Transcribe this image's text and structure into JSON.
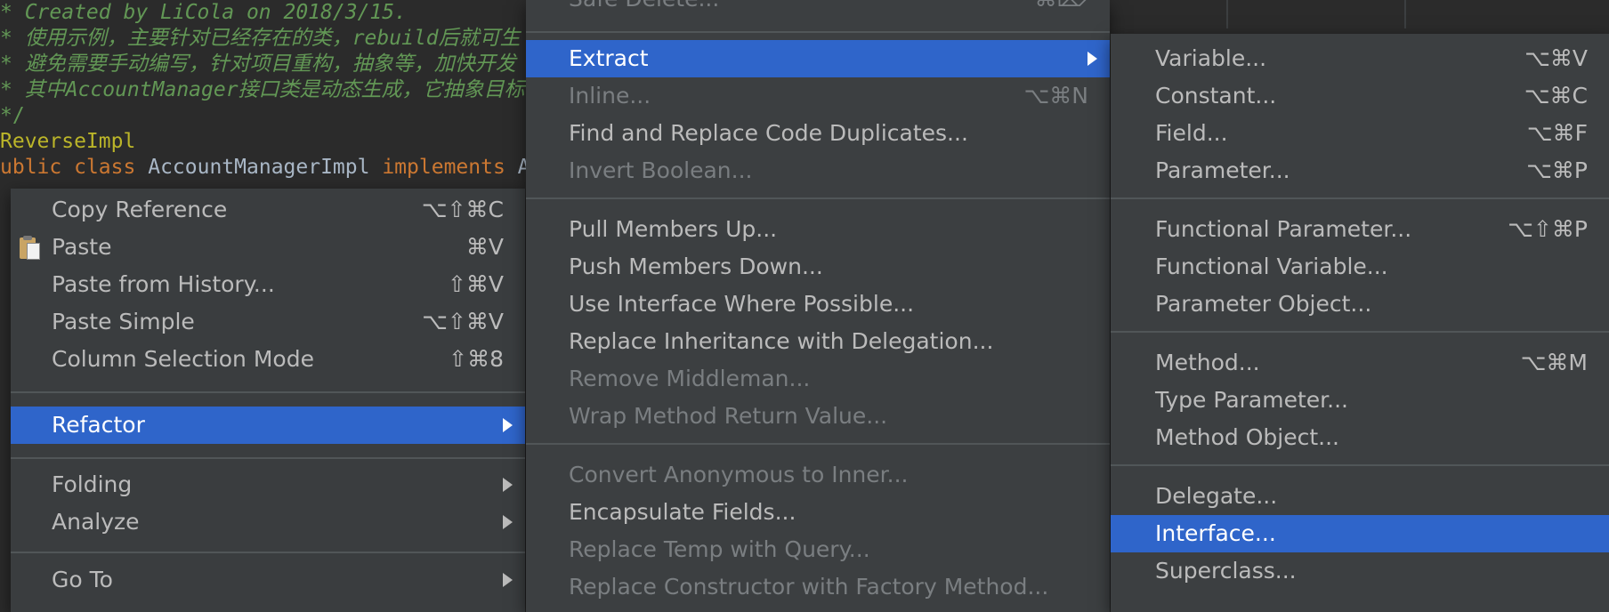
{
  "editor": {
    "lines": [
      "* Created by LiCola on 2018/3/15.",
      "* 使用示例，主要针对已经存在的类，rebuild后就可生",
      "* 避免需要手动编写，针对项目重构，抽象等，加快开发",
      "* 其中AccountManager接口类是动态生成，它抽象目标"
    ],
    "comment_end": "*/",
    "annotation": "ReverseImpl",
    "class_line": {
      "kw1": "ublic",
      "kw2": "class",
      "name": "AccountManagerImpl",
      "kw3": "implements",
      "tail": "Acc"
    }
  },
  "context_menu": {
    "items": [
      {
        "label": "Copy Reference",
        "shortcut": "⌥⇧⌘C"
      },
      {
        "label": "Paste",
        "shortcut": "⌘V",
        "icon": "paste-icon"
      },
      {
        "label": "Paste from History...",
        "shortcut": "⇧⌘V"
      },
      {
        "label": "Paste Simple",
        "shortcut": "⌥⇧⌘V"
      },
      {
        "label": "Column Selection Mode",
        "shortcut": "⇧⌘8"
      },
      {
        "label": "Refactor",
        "selected": true
      },
      {
        "label": "Folding"
      },
      {
        "label": "Analyze"
      },
      {
        "label": "Go To"
      }
    ]
  },
  "refactor_menu": {
    "items": [
      {
        "label": "Safe Delete...",
        "shortcut": "⌘⌦",
        "disabled": true
      },
      {
        "label": "Extract",
        "selected": true
      },
      {
        "label": "Inline...",
        "shortcut": "⌥⌘N",
        "disabled": true
      },
      {
        "label": "Find and Replace Code Duplicates..."
      },
      {
        "label": "Invert Boolean...",
        "disabled": true
      },
      {
        "label": "Pull Members Up..."
      },
      {
        "label": "Push Members Down..."
      },
      {
        "label": "Use Interface Where Possible..."
      },
      {
        "label": "Replace Inheritance with Delegation..."
      },
      {
        "label": "Remove Middleman...",
        "disabled": true
      },
      {
        "label": "Wrap Method Return Value...",
        "disabled": true
      },
      {
        "label": "Convert Anonymous to Inner...",
        "disabled": true
      },
      {
        "label": "Encapsulate Fields..."
      },
      {
        "label": "Replace Temp with Query...",
        "disabled": true
      },
      {
        "label": "Replace Constructor with Factory Method...",
        "disabled": true
      }
    ]
  },
  "extract_menu": {
    "items": [
      {
        "label": "Variable...",
        "shortcut": "⌥⌘V"
      },
      {
        "label": "Constant...",
        "shortcut": "⌥⌘C"
      },
      {
        "label": "Field...",
        "shortcut": "⌥⌘F"
      },
      {
        "label": "Parameter...",
        "shortcut": "⌥⌘P"
      },
      {
        "label": "Functional Parameter...",
        "shortcut": "⌥⇧⌘P"
      },
      {
        "label": "Functional Variable..."
      },
      {
        "label": "Parameter Object..."
      },
      {
        "label": "Method...",
        "shortcut": "⌥⌘M"
      },
      {
        "label": "Type Parameter..."
      },
      {
        "label": "Method Object..."
      },
      {
        "label": "Delegate..."
      },
      {
        "label": "Interface...",
        "selected": true
      },
      {
        "label": "Superclass..."
      }
    ]
  },
  "colors": {
    "selection": "#2f65ca",
    "menu_bg": "#3c3f41",
    "editor_bg": "#2b2b2b",
    "comment": "#629755",
    "keyword": "#cc7832",
    "annotation": "#bbb529"
  }
}
